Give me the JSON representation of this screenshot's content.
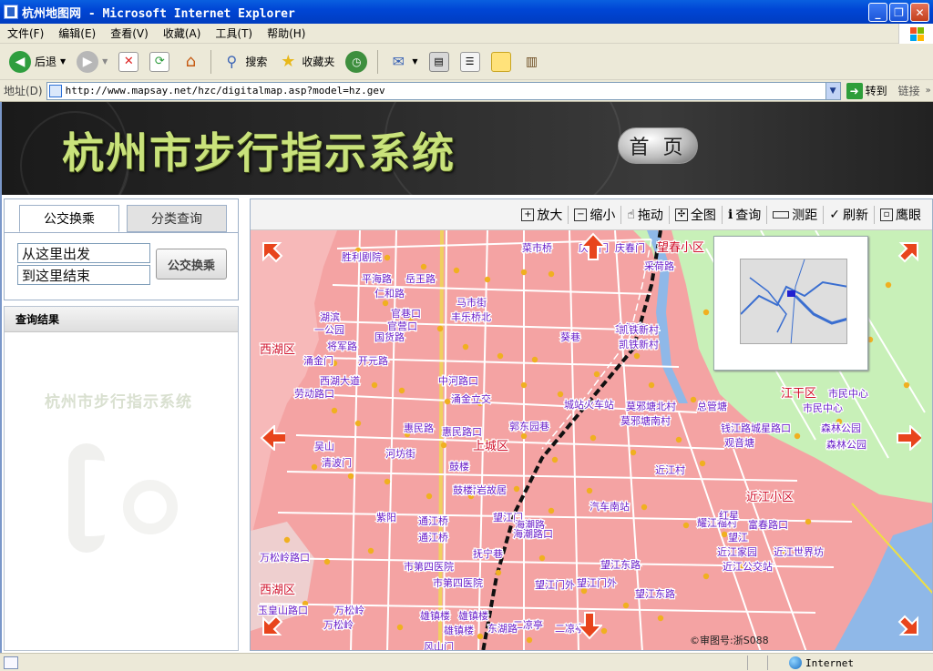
{
  "window": {
    "title": "杭州地图网 - Microsoft Internet Explorer"
  },
  "menu": [
    "文件(F)",
    "编辑(E)",
    "查看(V)",
    "收藏(A)",
    "工具(T)",
    "帮助(H)"
  ],
  "toolbar": {
    "back_label": "后退",
    "search_label": "搜索",
    "favorites_label": "收藏夹"
  },
  "address": {
    "label": "地址(D)",
    "url": "http://www.mapsay.net/hzc/digitalmap.asp?model=hz.gev",
    "go_label": "转到",
    "links_label": "链接"
  },
  "banner": {
    "title": "杭州市步行指示系统",
    "home_label": "首 页"
  },
  "search_panel": {
    "tabs": [
      "公交换乘",
      "分类查询"
    ],
    "from_value": "从这里出发",
    "to_value": "到这里结束",
    "transfer_button": "公交换乘"
  },
  "results": {
    "header": "查询结果",
    "watermark": "杭州市步行指示系统"
  },
  "map_tools": [
    "放大",
    "缩小",
    "拖动",
    "全图",
    "查询",
    "测距",
    "刷新",
    "鹰眼"
  ],
  "map": {
    "approval": "©审图号:浙S088",
    "labels": [
      "胜利剧院",
      "平海路",
      "岳王路",
      "仁和路",
      "官巷口",
      "官营口",
      "马市街",
      "丰乐桥北",
      "菜市桥",
      "庆春门",
      "庆春门",
      "望春小区",
      "采荷路",
      "湖滨",
      "一公园",
      "将军路",
      "国货路",
      "开元路",
      "涌金门",
      "西湖区",
      "西湖大道",
      "中河路口",
      "葵巷",
      "金衙庄",
      "凯铁新村",
      "凯铁新村",
      "劳动路口",
      "涌金立交",
      "城站火车站",
      "莫邪塘北村",
      "总管塘",
      "江干区",
      "市民中心",
      "市民中心",
      "惠民路",
      "惠民路口",
      "郭东园巷",
      "莫邪塘南村",
      "钱江路城星路口",
      "森林公园",
      "森林公园",
      "吴山",
      "清波门",
      "河坊街",
      "上城区",
      "鼓楼",
      "观音塘",
      "近江村",
      "胡雪岩故居",
      "鼓楼",
      "近江小区",
      "紫阳",
      "通江桥",
      "通江桥",
      "望江门",
      "海潮路",
      "汽车南站",
      "耀江福村",
      "富春路口",
      "万松岭路口",
      "市第四医院",
      "市第四医院",
      "抚宁巷",
      "海潮路口",
      "望江",
      "近江家园",
      "近江世界坊",
      "近江公交站",
      "西湖区",
      "望江东路",
      "望江门外",
      "望江门外",
      "玉皇山路口",
      "万松岭",
      "万松岭",
      "雄镇楼",
      "雄镇楼",
      "雄镇楼",
      "二凉亭",
      "二凉亭",
      "风山门",
      "东湖路",
      "红星",
      "望江东路"
    ]
  },
  "status": {
    "zone": "Internet"
  },
  "colors": {
    "urban": "#f4a3a3",
    "green_area": "#c8f0b8",
    "river": "#8fb8e8",
    "label": "#6a1fc9",
    "road": "#ffffff",
    "rail": "#111111",
    "poi": "#f0b020"
  }
}
